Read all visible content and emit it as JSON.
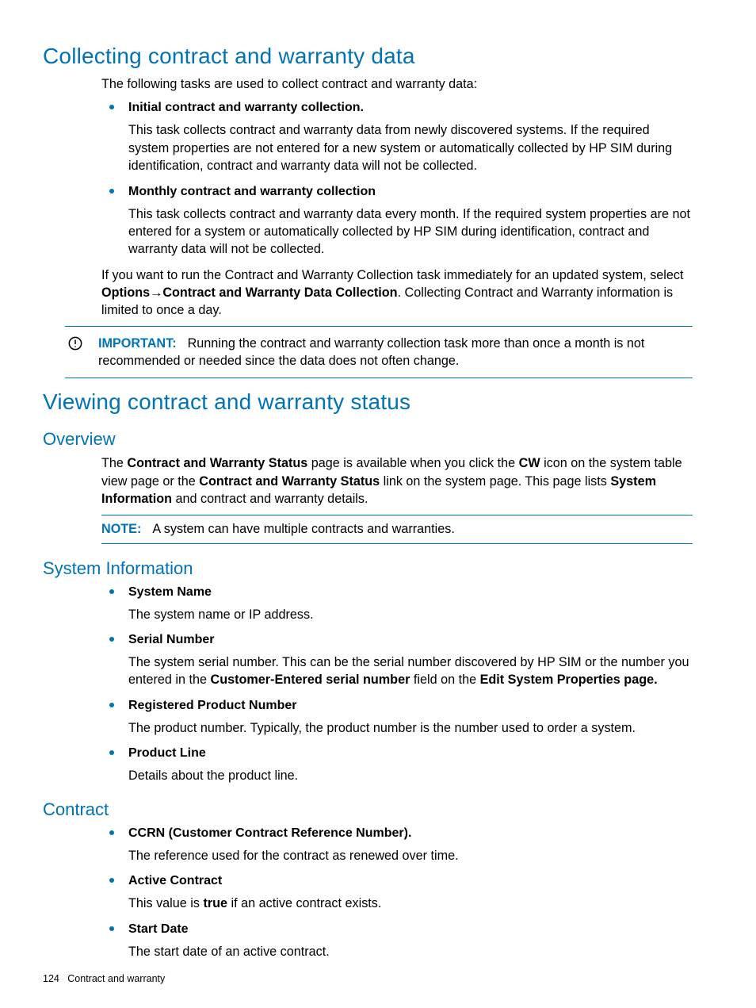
{
  "section1": {
    "title": "Collecting contract and warranty data",
    "intro": "The following tasks are used to collect contract and warranty data:",
    "bullets": [
      {
        "title": "Initial contract and warranty collection.",
        "desc": "This task collects contract and warranty data from newly discovered systems. If the required system properties are not entered for a new system or automatically collected by HP SIM during identification, contract and warranty data will not be collected."
      },
      {
        "title": "Monthly contract and warranty collection",
        "desc": "This task collects contract and warranty data every month. If the required system properties are not entered for a system or automatically collected by HP SIM during identification, contract and warranty data will not be collected."
      }
    ],
    "closing_pre": "If you want to run the Contract and Warranty Collection task immediately for an updated system, select ",
    "closing_bold1": "Options",
    "closing_arrow": "→",
    "closing_bold2": "Contract and Warranty Data Collection",
    "closing_post": ". Collecting Contract and Warranty information is limited to once a day.",
    "important_label": "IMPORTANT:",
    "important_text": "Running the contract and warranty collection task more than once a month is not recommended or needed since the data does not often change."
  },
  "section2": {
    "title": "Viewing contract and warranty status",
    "overview": {
      "heading": "Overview",
      "p_pre": "The ",
      "p_b1": "Contract and Warranty Status",
      "p_mid1": " page is available when you click the ",
      "p_b2": "CW",
      "p_mid2": " icon on the system table view page or the ",
      "p_b3": "Contract and Warranty Status",
      "p_mid3": " link on the system page. This page lists ",
      "p_b4": "System Information",
      "p_post": " and contract and warranty details.",
      "note_label": "NOTE:",
      "note_text": "A system can have multiple contracts and warranties."
    },
    "sysinfo": {
      "heading": "System Information",
      "items": [
        {
          "title": "System Name",
          "desc": "The system name or IP address."
        },
        {
          "title": "Serial Number",
          "desc_pre": "The system serial number. This can be the serial number discovered by HP SIM or the number you entered in the ",
          "desc_b1": "Customer-Entered serial number",
          "desc_mid": " field on the ",
          "desc_b2": "Edit System Properties page."
        },
        {
          "title": "Registered Product Number",
          "desc": "The product number. Typically, the product number is the number used to order a system."
        },
        {
          "title": "Product Line",
          "desc": "Details about the product line."
        }
      ]
    },
    "contract": {
      "heading": "Contract",
      "items": [
        {
          "title": "CCRN (Customer Contract Reference Number).",
          "desc": "The reference used for the contract as renewed over time."
        },
        {
          "title": "Active Contract",
          "desc_pre": "This value is ",
          "desc_b1": "true",
          "desc_post": " if an active contract exists."
        },
        {
          "title": "Start Date",
          "desc": "The start date of an active contract."
        }
      ]
    }
  },
  "footer": {
    "page_number": "124",
    "chapter": "Contract and warranty"
  }
}
